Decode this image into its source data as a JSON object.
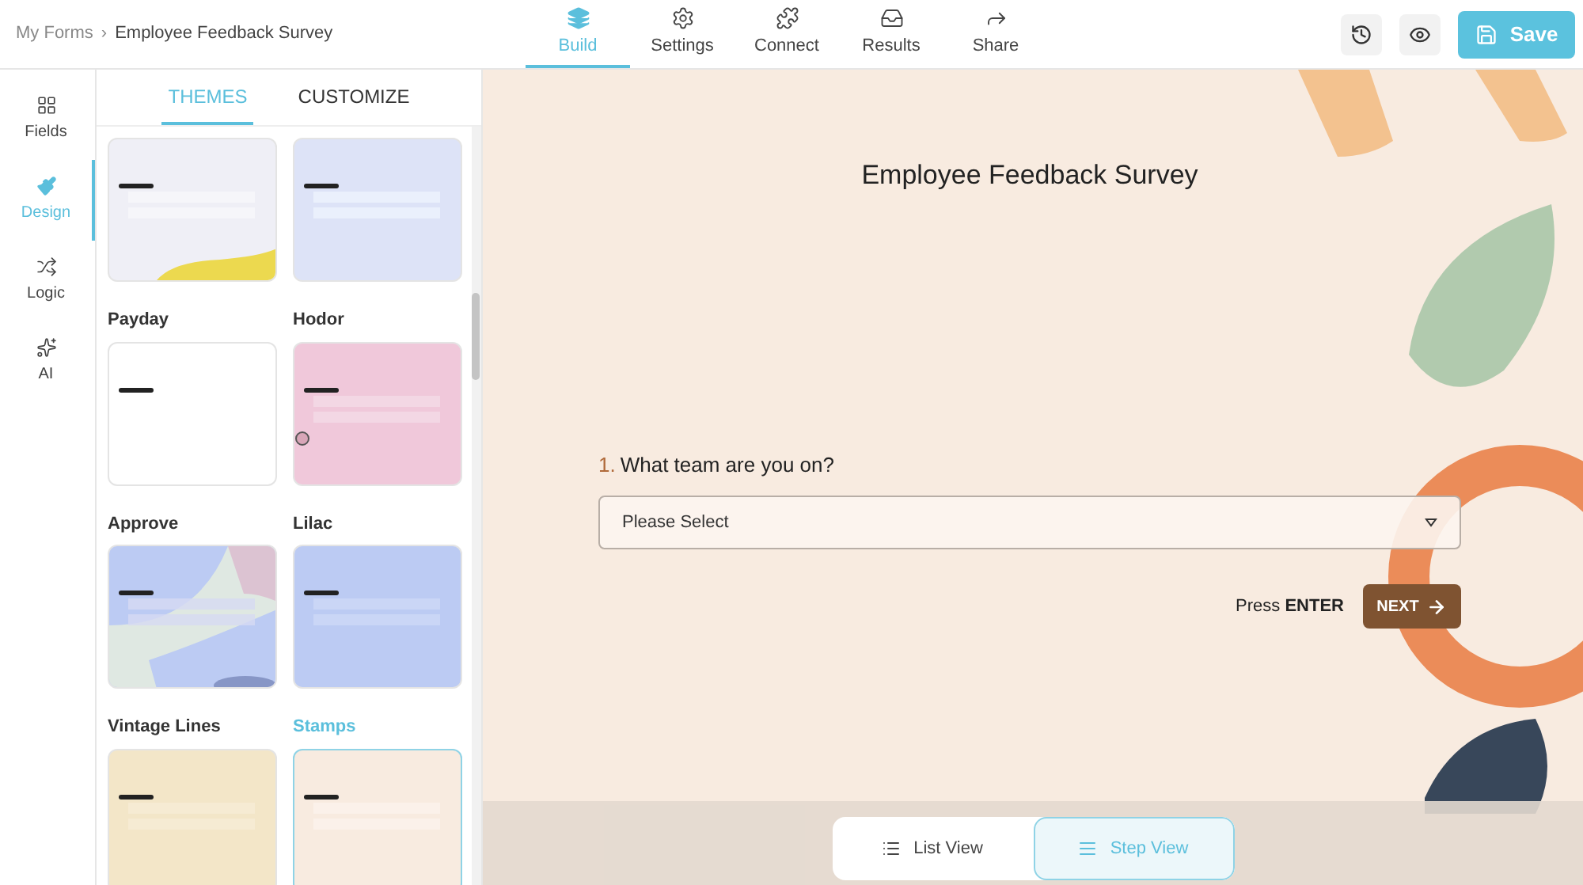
{
  "breadcrumb": {
    "parent": "My Forms",
    "separator": "›",
    "current": "Employee Feedback Survey"
  },
  "nav_tabs": [
    {
      "label": "Build",
      "selected": true
    },
    {
      "label": "Settings",
      "selected": false
    },
    {
      "label": "Connect",
      "selected": false
    },
    {
      "label": "Results",
      "selected": false
    },
    {
      "label": "Share",
      "selected": false
    }
  ],
  "save_button": "Save",
  "sidebar": {
    "items": [
      {
        "label": "Fields",
        "selected": false
      },
      {
        "label": "Design",
        "selected": true
      },
      {
        "label": "Logic",
        "selected": false
      },
      {
        "label": "AI",
        "selected": false
      }
    ]
  },
  "panel_tabs": [
    {
      "label": "THEMES",
      "selected": true
    },
    {
      "label": "CUSTOMIZE",
      "selected": false
    }
  ],
  "themes": [
    {
      "kind": "wave",
      "selected": false
    },
    {
      "kind": "circle",
      "selected": false
    },
    {
      "name": "Payday",
      "kind": "plain",
      "selected": false
    },
    {
      "name": "Hodor",
      "kind": "pink",
      "selected": false
    },
    {
      "name": "Approve",
      "kind": "shapes",
      "selected": false
    },
    {
      "name": "Lilac",
      "kind": "lilac",
      "selected": false
    },
    {
      "name": "Vintage Lines",
      "kind": "vintage",
      "selected": false
    },
    {
      "name": "Stamps",
      "kind": "stamps",
      "selected": true
    }
  ],
  "form": {
    "title": "Employee Feedback Survey",
    "question_number": "1.",
    "question": "What team are you on?",
    "select_placeholder": "Please Select",
    "hint_prefix": "Press",
    "hint_key": "ENTER",
    "next_button": "NEXT"
  },
  "view_toggle": [
    {
      "label": "List View",
      "selected": false
    },
    {
      "label": "Step View",
      "selected": true
    }
  ]
}
